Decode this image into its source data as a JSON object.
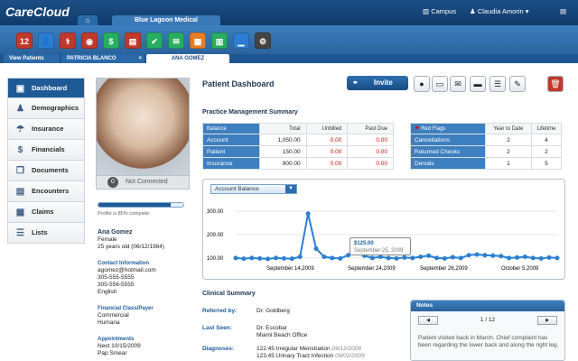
{
  "header": {
    "logo": "CareCloud",
    "home_icon": "home-icon",
    "main_tab": "Blue Lagoon Medical",
    "location": "Campus",
    "user": "Claudia Amorin"
  },
  "toolbar_icons": [
    {
      "name": "calendar-icon",
      "glyph": "12",
      "color": "#c0392b"
    },
    {
      "name": "people-icon",
      "glyph": "👤",
      "color": "#2d7dd2"
    },
    {
      "name": "patients-icon",
      "glyph": "⚕",
      "color": "#c0392b"
    },
    {
      "name": "globe-icon",
      "glyph": "◉",
      "color": "#c0392b"
    },
    {
      "name": "billing-icon",
      "glyph": "$",
      "color": "#27ae60"
    },
    {
      "name": "claims-icon",
      "glyph": "▤",
      "color": "#c0392b"
    },
    {
      "name": "check-icon",
      "glyph": "✔",
      "color": "#27ae60"
    },
    {
      "name": "mail-check-icon",
      "glyph": "✉",
      "color": "#27ae60"
    },
    {
      "name": "document-icon",
      "glyph": "▦",
      "color": "#e67e22"
    },
    {
      "name": "books-icon",
      "glyph": "▥",
      "color": "#27ae60"
    },
    {
      "name": "reports-icon",
      "glyph": "▁",
      "color": "#2d7dd2"
    },
    {
      "name": "settings-icon",
      "glyph": "⚙",
      "color": "#444444"
    }
  ],
  "patient_tabs": [
    {
      "label": "View Patients"
    },
    {
      "label": "PATRICIA BLANCO"
    },
    {
      "label": "ANA GOMEZ"
    }
  ],
  "sidebar": {
    "items": [
      {
        "label": "Dashboard",
        "icon": "home-icon",
        "glyph": "▣"
      },
      {
        "label": "Demographics",
        "icon": "person-icon",
        "glyph": "♟"
      },
      {
        "label": "Insurance",
        "icon": "umbrella-icon",
        "glyph": "☂"
      },
      {
        "label": "Financials",
        "icon": "dollar-icon",
        "glyph": "$"
      },
      {
        "label": "Documents",
        "icon": "documents-icon",
        "glyph": "❐"
      },
      {
        "label": "Encounters",
        "icon": "clipboard-icon",
        "glyph": "▤"
      },
      {
        "label": "Claims",
        "icon": "claims-icon",
        "glyph": "▦"
      },
      {
        "label": "Lists",
        "icon": "list-icon",
        "glyph": "☰"
      }
    ]
  },
  "patient": {
    "status_count": "0",
    "status": "Not Connected",
    "profile_progress": 0.85,
    "profile_text": "Profile is 85% complete",
    "name": "Ana Gomez",
    "gender": "Female",
    "age": "25 years old (06/12/1984)",
    "contact_head": "Contact Information",
    "email": "agomez@hotmail.com",
    "phone1": "305-555-5555",
    "phone2": "305-556-5555",
    "language": "English",
    "financial_head": "Financial Class/Payer",
    "financial_class": "Commercial",
    "payer": "Humana",
    "appointments_head": "Appointments",
    "next_appt": "Next 10/15/2009",
    "appt_type": "Pap Smear"
  },
  "dashboard": {
    "title": "Patient Dashboard",
    "invite": "Invite",
    "action_icons": [
      {
        "name": "map-pin-icon",
        "glyph": "●"
      },
      {
        "name": "print-icon",
        "glyph": "▭"
      },
      {
        "name": "email-icon",
        "glyph": "✉"
      },
      {
        "name": "card-icon",
        "glyph": "▬"
      },
      {
        "name": "message-icon",
        "glyph": "☰"
      },
      {
        "name": "edit-icon",
        "glyph": "✎"
      },
      {
        "name": "delete-icon",
        "glyph": "🗑"
      }
    ]
  },
  "pm_summary": {
    "title": "Practice Management Summary",
    "headers": [
      "Balance",
      "Total",
      "Unbilled",
      "Past Due"
    ],
    "rows": [
      {
        "label": "Account",
        "total": "1,050.00",
        "unbilled": "0.00",
        "past_due": "0.00"
      },
      {
        "label": "Patient",
        "total": "150.00",
        "unbilled": "0.00",
        "past_due": "0.00"
      },
      {
        "label": "Insurance",
        "total": "900.00",
        "unbilled": "0.00",
        "past_due": "0.00"
      }
    ]
  },
  "red_flags": {
    "headers": [
      "Red Flags",
      "Year to Date",
      "Lifetime"
    ],
    "rows": [
      {
        "label": "Cancellations",
        "ytd": "2",
        "lifetime": "4"
      },
      {
        "label": "Returned Checks",
        "ytd": "2",
        "lifetime": "2"
      },
      {
        "label": "Denials",
        "ytd": "1",
        "lifetime": "5"
      }
    ]
  },
  "chart_data": {
    "type": "line",
    "selector": "Account Balance",
    "y_ticks": [
      "300.00",
      "200.00",
      "100.00"
    ],
    "ylim": [
      80,
      320
    ],
    "x_ticks": [
      "September 14,2009",
      "September 24,2009",
      "September 26,2009",
      "October 5,2009"
    ],
    "series": [
      {
        "values": [
          100,
          97,
          100,
          98,
          96,
          100,
          98,
          97,
          105,
          290,
          140,
          105,
          100,
          98,
          112,
          125,
          110,
          100,
          105,
          100,
          98,
          102,
          100,
          105,
          110,
          100,
          98,
          103,
          100,
          112,
          115,
          112,
          110,
          108,
          100,
          102,
          105,
          100,
          98,
          102,
          100
        ]
      }
    ],
    "tooltip": {
      "value": "$125.00",
      "date": "September 25, 2009"
    }
  },
  "clinical": {
    "title": "Clinical Summary",
    "referred_lbl": "Referred by:",
    "referred": "Dr. Goldberg",
    "last_seen_lbl": "Last Seen:",
    "last_seen_1": "Dr. Escobar",
    "last_seen_2": "Miami Beach Office",
    "diagnoses_lbl": "Diagnoses:",
    "diag1": "122.45 Irregular Menstration",
    "diag1_date": "09/12/2009",
    "diag2": "123.45 Urinary Tract Infection",
    "diag2_date": "09/02/2009"
  },
  "notes": {
    "title": "Notes",
    "page": "1 / 12",
    "prev": "◀",
    "next": "▶",
    "text": "Patient visited back in March. Chief complaint has been regarding the lower back and along the right leg."
  }
}
